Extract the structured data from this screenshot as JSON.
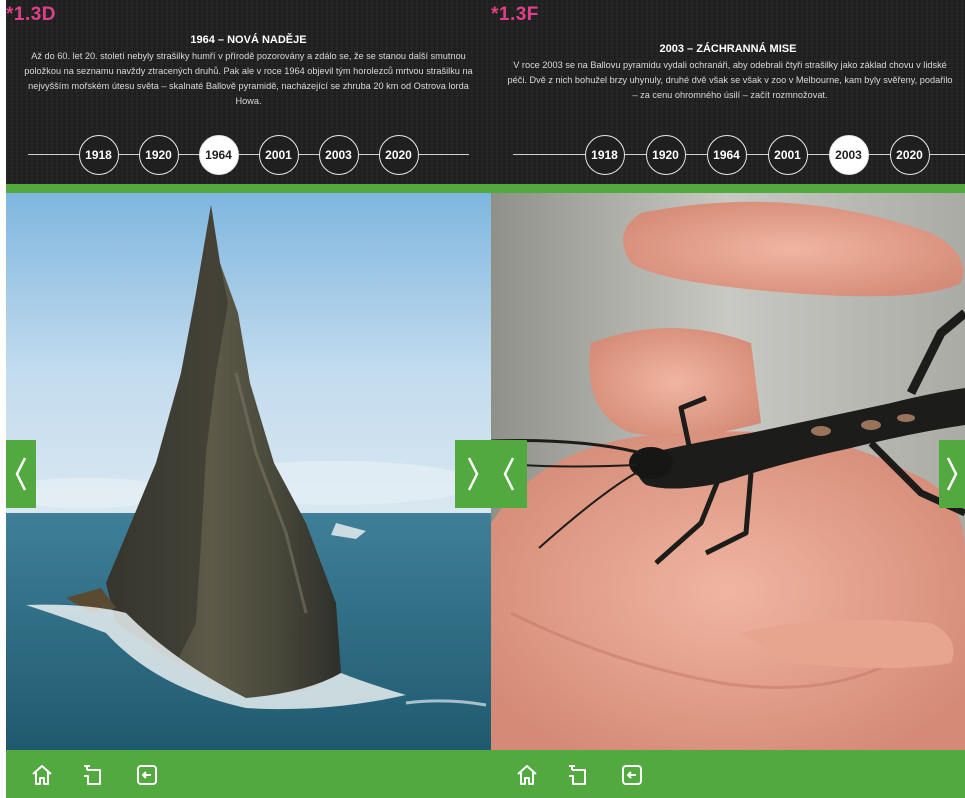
{
  "left_page": {
    "code": "*1.3D",
    "title": "1964 – NOVÁ NADĚJE",
    "text": "Až do 60. let 20. století nebyly strašilky humří v přírodě pozorovány a zdálo se, že se stanou další smutnou položkou na seznamu navždy ztracených druhů. Pak ale v roce 1964 objevil tým horolezců mrtvou strašilku na nejvyšším mořském útesu světa – skalnaté Ballově pyramidě, nacházející se zhruba 20 km od Ostrova lorda Howa.",
    "timeline": [
      "1918",
      "1920",
      "1964",
      "2001",
      "2003",
      "2020"
    ],
    "active_year": "1964",
    "photo": "ball-pyramid-rock-in-sea"
  },
  "right_page": {
    "code": "*1.3F",
    "title": "2003 – ZÁCHRANNÁ MISE",
    "text": "V roce 2003 se na Ballovu pyramidu vydali ochranáři, aby odebrali čtyři strašilky jako základ chovu v lidské péči. Dvě z nich bohužel brzy uhynuly, druhé dvě však se však v zoo v Melbourne, kam byly svěřeny, podařilo – za cenu ohromného úsilí – začít rozmnožovat.",
    "timeline": [
      "1918",
      "1920",
      "1964",
      "2001",
      "2003",
      "2020"
    ],
    "active_year": "2003",
    "photo": "stick-insect-on-hand"
  },
  "footer_icons": [
    "home-icon",
    "toc-icon",
    "exit-icon"
  ],
  "nav_icons": [
    "chevron-left-icon",
    "chevron-right-icon"
  ],
  "colors": {
    "green": "#51a93f",
    "header_bg": "#1f1f1f",
    "code_pink": "#e0408a",
    "white": "#ffffff"
  }
}
